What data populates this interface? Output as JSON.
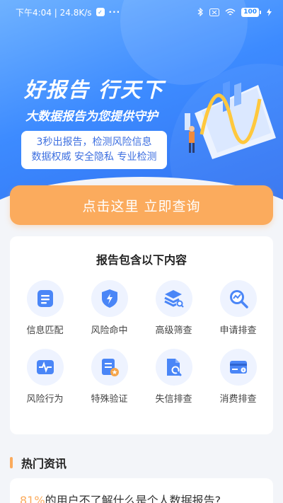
{
  "status_bar": {
    "time_speed": "下午4:04 | 24.8K/s",
    "shield": "✓",
    "more": "···",
    "battery": "100"
  },
  "hero": {
    "title": "好报告  行天下",
    "subtitle": "大数据报告为您提供守护",
    "feature_line1": "3秒出报告，检测风险信息",
    "feature_line2": "数据权威  安全隐私  专业检测"
  },
  "query_button": {
    "label": "点击这里  立即查询"
  },
  "report": {
    "title": "报告包含以下内容",
    "items": [
      {
        "label": "信息匹配",
        "icon": "document-list-icon"
      },
      {
        "label": "风险命中",
        "icon": "shield-bolt-icon"
      },
      {
        "label": "高级筛查",
        "icon": "layers-search-icon"
      },
      {
        "label": "申请排查",
        "icon": "chart-search-icon"
      },
      {
        "label": "风险行为",
        "icon": "pulse-monitor-icon"
      },
      {
        "label": "特殊验证",
        "icon": "document-star-icon"
      },
      {
        "label": "失信排查",
        "icon": "file-search-icon"
      },
      {
        "label": "消费排查",
        "icon": "card-coin-icon"
      }
    ]
  },
  "news": {
    "title": "热门资讯",
    "item_pct": "81%",
    "item_text": "的用户不了解什么是个人数据报告?"
  },
  "colors": {
    "brand_blue": "#3d8bff",
    "accent_orange": "#fbab5d"
  }
}
